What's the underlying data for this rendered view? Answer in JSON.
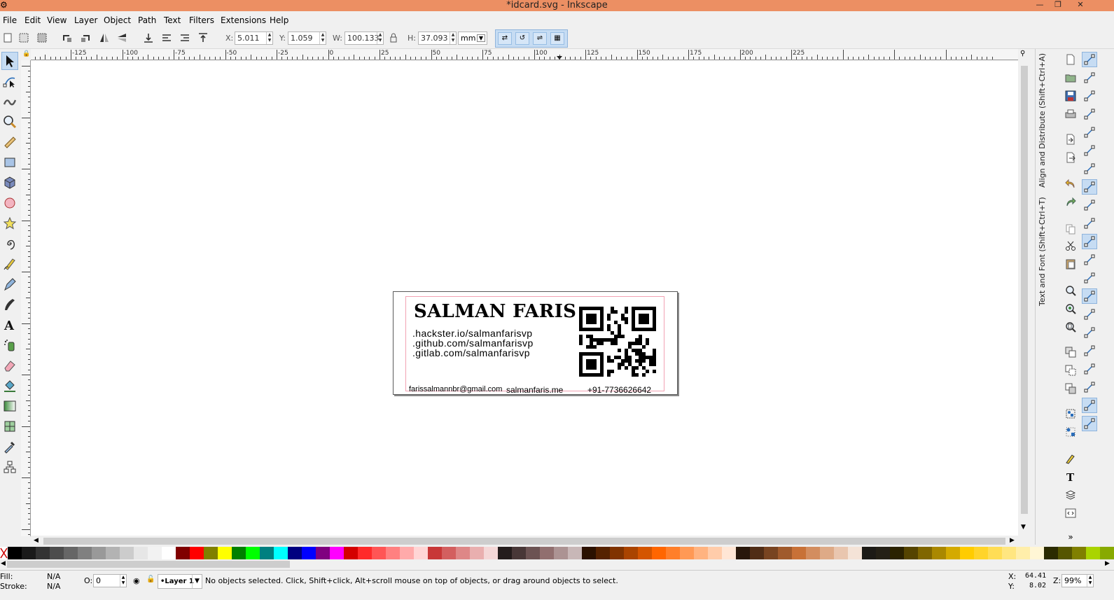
{
  "window": {
    "title": "*idcard.svg - Inkscape"
  },
  "menu": [
    "File",
    "Edit",
    "View",
    "Layer",
    "Object",
    "Path",
    "Text",
    "Filters",
    "Extensions",
    "Help"
  ],
  "toolbar": {
    "x_label": "X:",
    "x_value": "5.011",
    "y_label": "Y:",
    "y_value": "1.059",
    "w_label": "W:",
    "w_value": "100.133",
    "h_label": "H:",
    "h_value": "37.093",
    "unit": "mm"
  },
  "ruler": {
    "h_labels": [
      "-125",
      "-100",
      "-75",
      "-50",
      "-25",
      "0",
      "25",
      "50",
      "75",
      "100",
      "125",
      "150",
      "175",
      "200",
      "225"
    ]
  },
  "dock": {
    "align_tab": "Align and Distribute (Shift+Ctrl+A)",
    "text_tab": "Text and Font (Shift+Ctrl+T)"
  },
  "card": {
    "name": "SALMAN FARIS",
    "links": [
      ".hackster.io/salmanfarisvp",
      ".github.com/salmanfarisvp",
      ".gitlab.com/salmanfarisvp"
    ],
    "email": "farissalmannbr@gmail.com",
    "website": "salmanfaris.me",
    "phone": "+91-7736626642"
  },
  "status": {
    "fill_label": "Fill:",
    "fill_value": "N/A",
    "stroke_label": "Stroke:",
    "stroke_value": "N/A",
    "opacity_label": "O:",
    "opacity_value": "0",
    "layer": "•Layer 1",
    "message": "No objects selected. Click, Shift+click, Alt+scroll mouse on top of objects, or drag around objects to select.",
    "x_label": "X:",
    "x_value": "64.41",
    "y_label": "Y:",
    "y_value": "8.02",
    "zoom_label": "Z:",
    "zoom_value": "99%"
  },
  "palette_colors": [
    "#000000",
    "#1a1a1a",
    "#333333",
    "#4d4d4d",
    "#666666",
    "#808080",
    "#999999",
    "#b3b3b3",
    "#cccccc",
    "#e6e6e6",
    "#f2f2f2",
    "#ffffff",
    "#800000",
    "#ff0000",
    "#808000",
    "#ffff00",
    "#008000",
    "#00ff00",
    "#008080",
    "#00ffff",
    "#000080",
    "#0000ff",
    "#800080",
    "#ff00ff",
    "#d40000",
    "#ff2a2a",
    "#ff5555",
    "#ff8080",
    "#ffaaaa",
    "#ffd5d5",
    "#c83737",
    "#d35f5f",
    "#de8787",
    "#e9afaf",
    "#f4d7d7",
    "#241c1c",
    "#483737",
    "#6c5353",
    "#916f6f",
    "#ac9393",
    "#c8b7b7",
    "#2b1100",
    "#552200",
    "#803300",
    "#aa4400",
    "#d45500",
    "#ff6600",
    "#ff7f2a",
    "#ff9955",
    "#ffb380",
    "#ffccaa",
    "#ffe6d5",
    "#28170b",
    "#502d16",
    "#784421",
    "#a05a2c",
    "#c87137",
    "#d38d5f",
    "#deaa87",
    "#e9c6af",
    "#f4e3d7",
    "#1c1a16",
    "#242016",
    "#2b2200",
    "#554400",
    "#806600",
    "#aa8800",
    "#d4aa00",
    "#ffcc00",
    "#ffd42a",
    "#ffdd55",
    "#ffe680",
    "#ffeeaa",
    "#fff6d5",
    "#2b2b00",
    "#555500",
    "#808000",
    "#aad400",
    "#88aa00"
  ]
}
